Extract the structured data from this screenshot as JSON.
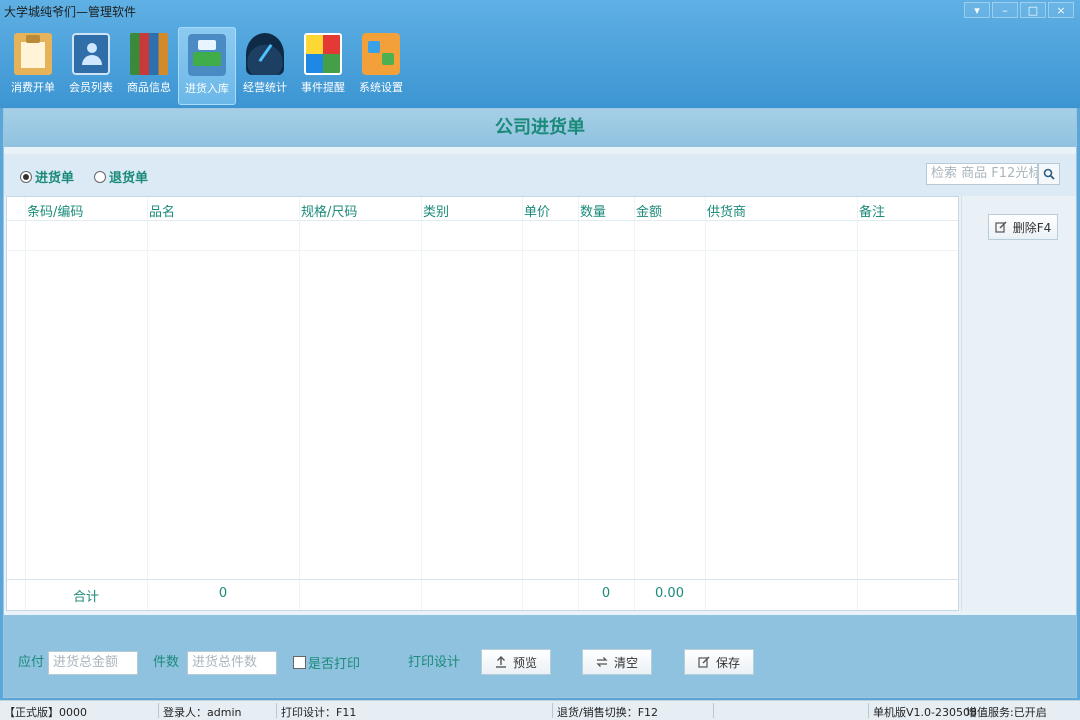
{
  "window": {
    "title": "大学城纯爷们—管理软件",
    "controls": [
      "▾",
      "–",
      "□",
      "×"
    ]
  },
  "ribbon": [
    {
      "label": "消费开单",
      "icon": "clipboard-icon",
      "active": false
    },
    {
      "label": "会员列表",
      "icon": "member-card-icon",
      "active": false
    },
    {
      "label": "商品信息",
      "icon": "books-icon",
      "active": false
    },
    {
      "label": "进货入库",
      "icon": "truck-icon",
      "active": true
    },
    {
      "label": "经营统计",
      "icon": "gauge-icon",
      "active": false
    },
    {
      "label": "事件提醒",
      "icon": "alert-windows-icon",
      "active": false
    },
    {
      "label": "系统设置",
      "icon": "settings-folder-icon",
      "active": false
    }
  ],
  "page": {
    "heading": "公司进货单"
  },
  "options": {
    "purchase_label": "进货单",
    "return_label": "退货单",
    "selected": "进货单",
    "search_placeholder": "检索 商品 F12光标"
  },
  "grid": {
    "columns": [
      "条码/编码",
      "品名",
      "规格/尺码",
      "类别",
      "单价",
      "数量",
      "金额",
      "供货商",
      "备注"
    ],
    "rows": [],
    "totals": {
      "label": "合计",
      "name_count": "0",
      "quantity": "0",
      "amount": "0.00"
    }
  },
  "side": {
    "delete_label": "删除F4"
  },
  "bottom": {
    "payable_label": "应付",
    "payable_placeholder": "进货总金额",
    "pieces_label": "件数",
    "pieces_placeholder": "进货总件数",
    "print_check_label": "是否打印",
    "print_check": false,
    "print_design_label": "打印设计",
    "preview_label": "预览",
    "clear_label": "清空",
    "save_label": "保存"
  },
  "status": {
    "edition": "【正式版】0000",
    "login": "登录人：admin",
    "print_design": "打印设计：F11",
    "switch": "退货/销售切换：F12",
    "version": "单机版V1.0-230508",
    "service": "增值服务:已开启"
  },
  "colors": {
    "accent_text": "#1b8a7a",
    "titlebar": "#4aa0dc",
    "panel": "#8fc2df"
  }
}
